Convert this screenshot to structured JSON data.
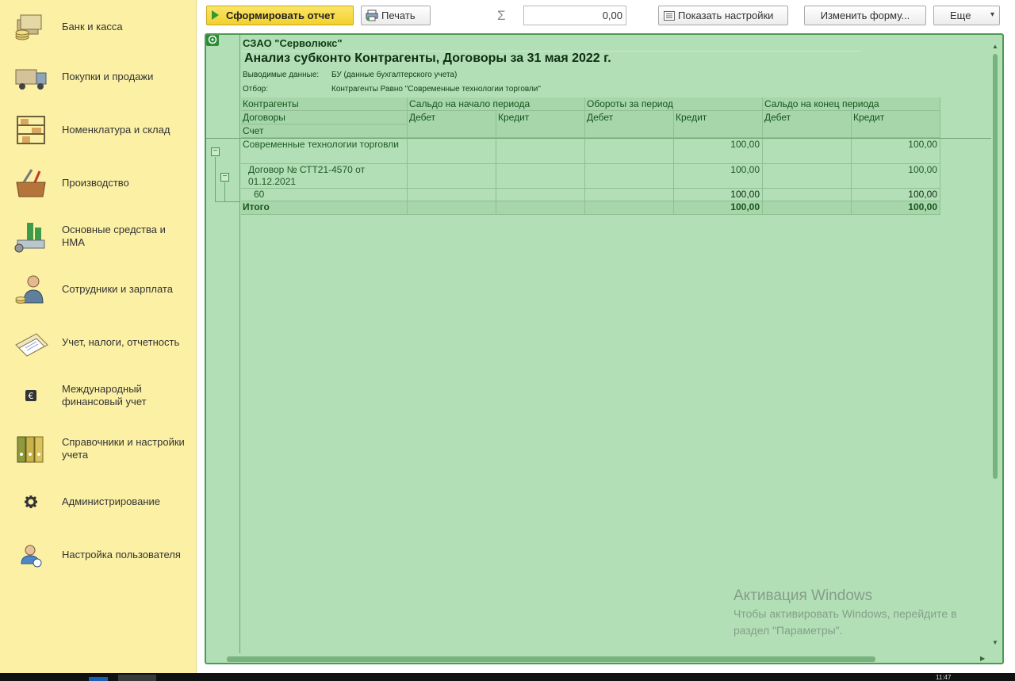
{
  "sidebar": {
    "items": [
      {
        "label": "Банк и касса",
        "icon": "bank-cash-icon"
      },
      {
        "label": "Покупки и продажи",
        "icon": "truck-icon"
      },
      {
        "label": "Номенклатура и склад",
        "icon": "warehouse-shelf-icon"
      },
      {
        "label": "Производство",
        "icon": "toolbox-icon"
      },
      {
        "label": "Основные средства и НМА",
        "icon": "assets-building-icon"
      },
      {
        "label": "Сотрудники и зарплата",
        "icon": "employee-icon"
      },
      {
        "label": "Учет, налоги, отчетность",
        "icon": "documents-icon"
      },
      {
        "label": "Международный финансовый учет",
        "icon": "euro-icon"
      },
      {
        "label": "Справочники и настройки учета",
        "icon": "binders-icon"
      },
      {
        "label": "Администрирование",
        "icon": "gear-icon"
      },
      {
        "label": "Настройка пользователя",
        "icon": "user-settings-icon"
      }
    ]
  },
  "toolbar": {
    "generate_label": "Сформировать отчет",
    "print_label": "Печать",
    "sum_symbol": "Σ",
    "sum_value": "0,00",
    "show_settings_label": "Показать настройки",
    "change_form_label": "Изменить форму...",
    "more_label": "Еще",
    "more_arrow": "▾"
  },
  "report": {
    "organization": "СЗАО \"Серволюкс\"",
    "title": "Анализ субконто Контрагенты, Договоры за 31 мая 2022 г.",
    "output_label": "Выводимые данные:",
    "output_value": "БУ (данные бухгалтерского учета)",
    "filter_label": "Отбор:",
    "filter_value": "Контрагенты Равно \"Современные технологии торговли\"",
    "columns": {
      "dim1": "Контрагенты",
      "dim2": "Договоры",
      "dim3": "Счет",
      "opening": "Сальдо на начало периода",
      "turnover": "Обороты за период",
      "closing": "Сальдо на конец периода",
      "debit": "Дебет",
      "credit": "Кредит"
    },
    "rows": [
      {
        "name": "Современные технологии торговли",
        "open_dt": "",
        "open_ct": "",
        "turn_dt": "",
        "turn_ct": "100,00",
        "close_dt": "",
        "close_ct": "100,00"
      },
      {
        "name": "Договор № СТТ21-4570 от 01.12.2021",
        "open_dt": "",
        "open_ct": "",
        "turn_dt": "",
        "turn_ct": "100,00",
        "close_dt": "",
        "close_ct": "100,00"
      },
      {
        "name": "60",
        "open_dt": "",
        "open_ct": "",
        "turn_dt": "",
        "turn_ct": "100,00",
        "close_dt": "",
        "close_ct": "100,00"
      }
    ],
    "total": {
      "name": "Итого",
      "turn_ct": "100,00",
      "close_ct": "100,00"
    },
    "toggle_minus": "−"
  },
  "activation": {
    "title": "Активация Windows",
    "line1": "Чтобы активировать Windows, перейдите в",
    "line2": "раздел \"Параметры\"."
  },
  "taskbar": {
    "clock": "11:47"
  }
}
